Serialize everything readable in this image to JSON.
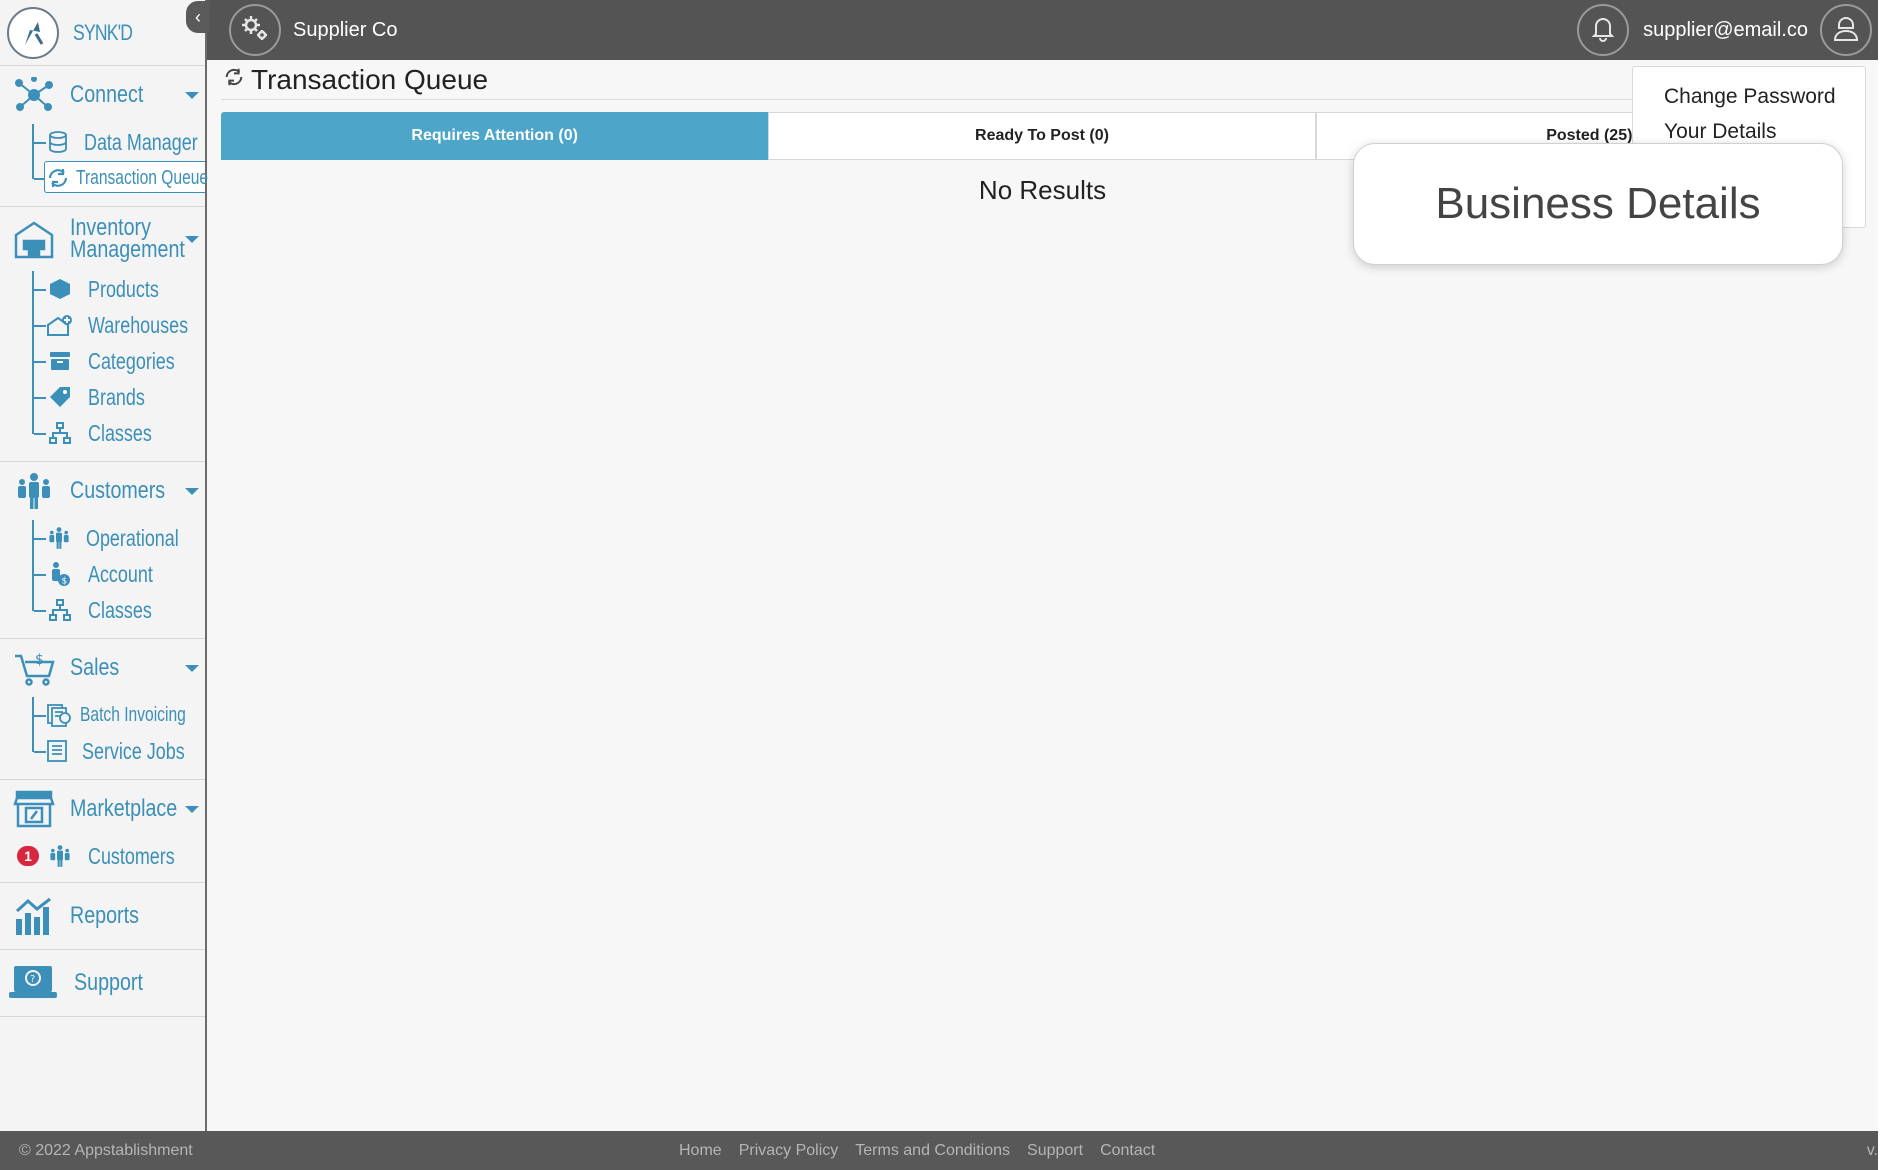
{
  "brand": {
    "name": "SYNK'D"
  },
  "sidebar": {
    "sections": [
      {
        "label": "Connect",
        "icon": "network-icon",
        "items": [
          {
            "label": "Data Manager",
            "icon": "database-icon"
          },
          {
            "label": "Transaction Queue",
            "icon": "sync-icon",
            "active": true
          }
        ]
      },
      {
        "label": "Inventory Management",
        "icon": "warehouse-icon",
        "items": [
          {
            "label": "Products",
            "icon": "box-icon"
          },
          {
            "label": "Warehouses",
            "icon": "warehouse-add-icon"
          },
          {
            "label": "Categories",
            "icon": "archive-icon"
          },
          {
            "label": "Brands",
            "icon": "tag-icon"
          },
          {
            "label": "Classes",
            "icon": "hierarchy-icon"
          }
        ]
      },
      {
        "label": "Customers",
        "icon": "people-icon",
        "items": [
          {
            "label": "Operational",
            "icon": "people-icon"
          },
          {
            "label": "Account",
            "icon": "money-person-icon"
          },
          {
            "label": "Classes",
            "icon": "hierarchy-icon"
          }
        ]
      },
      {
        "label": "Sales",
        "icon": "cart-icon",
        "items": [
          {
            "label": "Batch Invoicing",
            "icon": "invoice-batch-icon"
          },
          {
            "label": "Service Jobs",
            "icon": "document-icon"
          }
        ]
      },
      {
        "label": "Marketplace",
        "icon": "store-icon",
        "items": [
          {
            "label": "Customers",
            "icon": "people-icon",
            "badge": "1"
          }
        ]
      },
      {
        "label": "Reports",
        "icon": "chart-icon",
        "items": []
      },
      {
        "label": "Support",
        "icon": "laptop-help-icon",
        "items": []
      }
    ]
  },
  "topbar": {
    "company": "Supplier Co",
    "user_email": "supplier@email.co"
  },
  "page": {
    "title": "Transaction Queue",
    "empty_text": "No Results"
  },
  "tabs": [
    {
      "label": "Requires Attention (0)",
      "active": true
    },
    {
      "label": "Ready To Post (0)",
      "active": false
    },
    {
      "label": "Posted (25)",
      "active": false
    }
  ],
  "user_menu": {
    "items": [
      "Change Password",
      "Your Details"
    ],
    "highlight": "Business Details"
  },
  "footer": {
    "copyright": "© 2022 Appstablishment",
    "links": [
      "Home",
      "Privacy Policy",
      "Terms and Conditions",
      "Support",
      "Contact"
    ],
    "version": "v."
  },
  "colors": {
    "accent": "#3c8fb8",
    "tab_active": "#4da5c9",
    "topbar": "#545454",
    "badge": "#d7263d"
  }
}
